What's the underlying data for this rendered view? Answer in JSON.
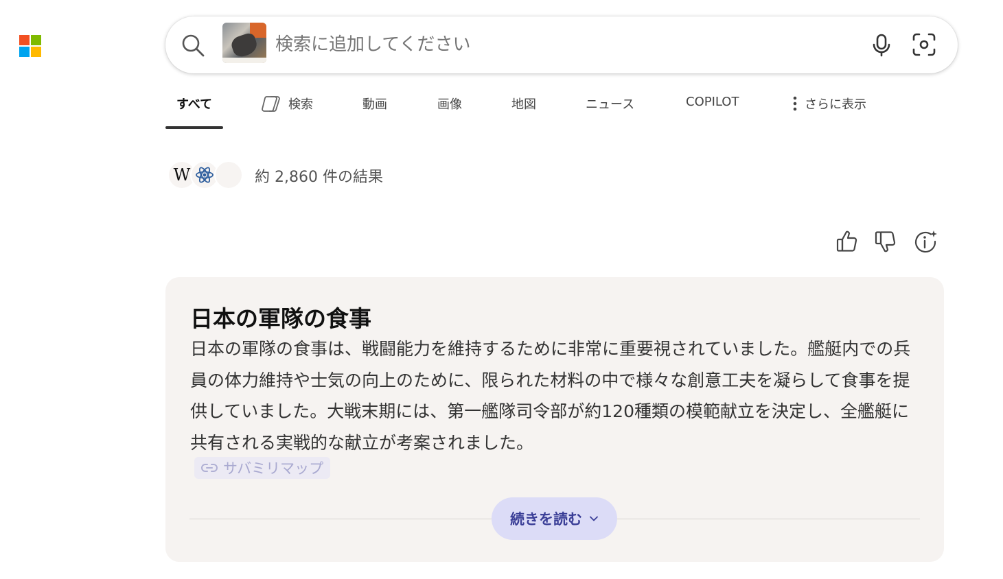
{
  "brand": {
    "logo_colors": [
      "#f25022",
      "#7fba00",
      "#00a4ef",
      "#ffb900"
    ]
  },
  "search": {
    "placeholder": "検索に追加してください",
    "value": ""
  },
  "nav": {
    "tabs": [
      {
        "label": "すべて",
        "active": true
      },
      {
        "label": "検索",
        "icon": "copilot-icon"
      },
      {
        "label": "動画"
      },
      {
        "label": "画像"
      },
      {
        "label": "地図"
      },
      {
        "label": "ニュース"
      },
      {
        "label": "COPILOT"
      },
      {
        "label": "さらに表示",
        "icon": "more-vertical-icon"
      }
    ]
  },
  "sources": {
    "wiki_letter": "W",
    "count_text": "約 2,860 件の結果"
  },
  "answer": {
    "title": "日本の軍隊の食事",
    "body": "日本の軍隊の食事は、戦闘能力を維持するために非常に重要視されていました。艦艇内での兵員の体力維持や士気の向上のために、限られた材料の中で様々な創意工夫を凝らして食事を提供していました。大戦末期には、第一艦隊司令部が約120種類の模範献立を決定し、全艦艇に共有される実戦的な献立が考案されました。",
    "citation": "サバミリマップ",
    "read_more": "続きを読む"
  },
  "colors": {
    "card_bg": "#f6f3f1",
    "accent_button_bg": "#dcdcf7",
    "accent_button_text": "#3a3e97"
  }
}
